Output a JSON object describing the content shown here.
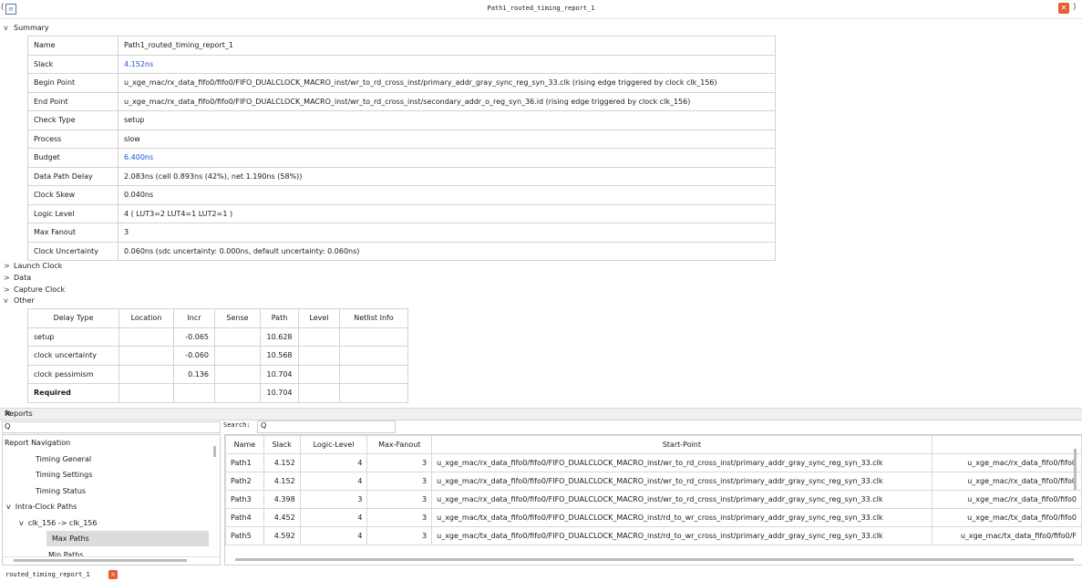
{
  "window": {
    "title": "Path1_routed_timing_report_1"
  },
  "sections": {
    "summary": "Summary",
    "launch_clock": "Launch Clock",
    "data": "Data",
    "capture_clock": "Capture Clock",
    "other": "Other"
  },
  "summary": [
    {
      "key": "Name",
      "value": "Path1_routed_timing_report_1"
    },
    {
      "key": "Slack",
      "value": "4.152ns"
    },
    {
      "key": "Begin Point",
      "value": "u_xge_mac/rx_data_fifo0/fifo0/FIFO_DUALCLOCK_MACRO_inst/wr_to_rd_cross_inst/primary_addr_gray_sync_reg_syn_33.clk (rising edge triggered by clock clk_156)"
    },
    {
      "key": "End Point",
      "value": "u_xge_mac/rx_data_fifo0/fifo0/FIFO_DUALCLOCK_MACRO_inst/wr_to_rd_cross_inst/secondary_addr_o_reg_syn_36.id (rising edge triggered by clock clk_156)"
    },
    {
      "key": "Check Type",
      "value": "setup"
    },
    {
      "key": "Process",
      "value": "slow"
    },
    {
      "key": "Budget",
      "value": "6.400ns"
    },
    {
      "key": "Data Path Delay",
      "value": "2.083ns (cell 0.893ns (42%), net 1.190ns (58%))"
    },
    {
      "key": "Clock Skew",
      "value": "0.040ns"
    },
    {
      "key": "Logic Level",
      "value": "4 ( LUT3=2  LUT4=1  LUT2=1 )"
    },
    {
      "key": "Max Fanout",
      "value": "3"
    },
    {
      "key": "Clock Uncertainty",
      "value": "0.060ns (sdc uncertainty: 0.000ns, default uncertainty: 0.060ns)"
    }
  ],
  "delay_table": {
    "headers": [
      "Delay Type",
      "Location",
      "Incr",
      "Sense",
      "Path",
      "Level",
      "Netlist Info"
    ],
    "rows": [
      [
        "setup",
        "",
        "-0.065",
        "",
        "10.628",
        "",
        ""
      ],
      [
        "clock uncertainty",
        "",
        "-0.060",
        "",
        "10.568",
        "",
        ""
      ],
      [
        "clock pessimism",
        "",
        "0.136",
        "",
        "10.704",
        "",
        ""
      ],
      [
        "Required",
        "",
        "",
        "",
        "10.704",
        "",
        ""
      ]
    ]
  },
  "reports": {
    "title": "Reports",
    "search_glyph": "Q",
    "search_label": "Search:",
    "nav": [
      {
        "label": "Report Navigation",
        "indent": 0,
        "arrow": ""
      },
      {
        "label": "Timing General",
        "indent": 1,
        "arrow": ""
      },
      {
        "label": "Timing Settings",
        "indent": 1,
        "arrow": ""
      },
      {
        "label": "Timing Status",
        "indent": 1,
        "arrow": ""
      },
      {
        "label": "Intra-Clock Paths",
        "indent": 0,
        "arrow": "v"
      },
      {
        "label": "clk_156 -> clk_156",
        "indent": 1,
        "arrow": "v"
      },
      {
        "label": "Max Paths",
        "indent": 2,
        "arrow": "",
        "selected": true
      },
      {
        "label": "Min Paths",
        "indent": 2,
        "arrow": ""
      }
    ],
    "paths_headers": [
      "Name",
      "Slack",
      "Logic-Level",
      "Max-Fanout",
      "Start-Point",
      ""
    ],
    "paths": [
      [
        "Path1",
        "4.152",
        "4",
        "3",
        "u_xge_mac/rx_data_fifo0/fifo0/FIFO_DUALCLOCK_MACRO_inst/wr_to_rd_cross_inst/primary_addr_gray_sync_reg_syn_33.clk",
        "u_xge_mac/rx_data_fifo0/fifo0"
      ],
      [
        "Path2",
        "4.152",
        "4",
        "3",
        "u_xge_mac/rx_data_fifo0/fifo0/FIFO_DUALCLOCK_MACRO_inst/wr_to_rd_cross_inst/primary_addr_gray_sync_reg_syn_33.clk",
        "u_xge_mac/rx_data_fifo0/fifo0"
      ],
      [
        "Path3",
        "4.398",
        "3",
        "3",
        "u_xge_mac/rx_data_fifo0/fifo0/FIFO_DUALCLOCK_MACRO_inst/wr_to_rd_cross_inst/primary_addr_gray_sync_reg_syn_33.clk",
        "u_xge_mac/rx_data_fifo0/fifo0"
      ],
      [
        "Path4",
        "4.452",
        "4",
        "3",
        "u_xge_mac/tx_data_fifo0/fifo0/FIFO_DUALCLOCK_MACRO_inst/rd_to_wr_cross_inst/primary_addr_gray_sync_reg_syn_33.clk",
        "u_xge_mac/tx_data_fifo0/fifo0"
      ],
      [
        "Path5",
        "4.592",
        "4",
        "3",
        "u_xge_mac/tx_data_fifo0/fifo0/FIFO_DUALCLOCK_MACRO_inst/rd_to_wr_cross_inst/primary_addr_gray_sync_reg_syn_33.clk",
        "u_xge_mac/tx_data_fifo0/fifo0/F"
      ]
    ]
  },
  "bottom_tab": {
    "label": "routed_timing_report_1"
  },
  "icons": {
    "close": "×",
    "expanded": "v",
    "collapsed": ">"
  },
  "colors": {
    "link_blue": "#1f4fd6",
    "close_orange": "#e25d2f"
  }
}
